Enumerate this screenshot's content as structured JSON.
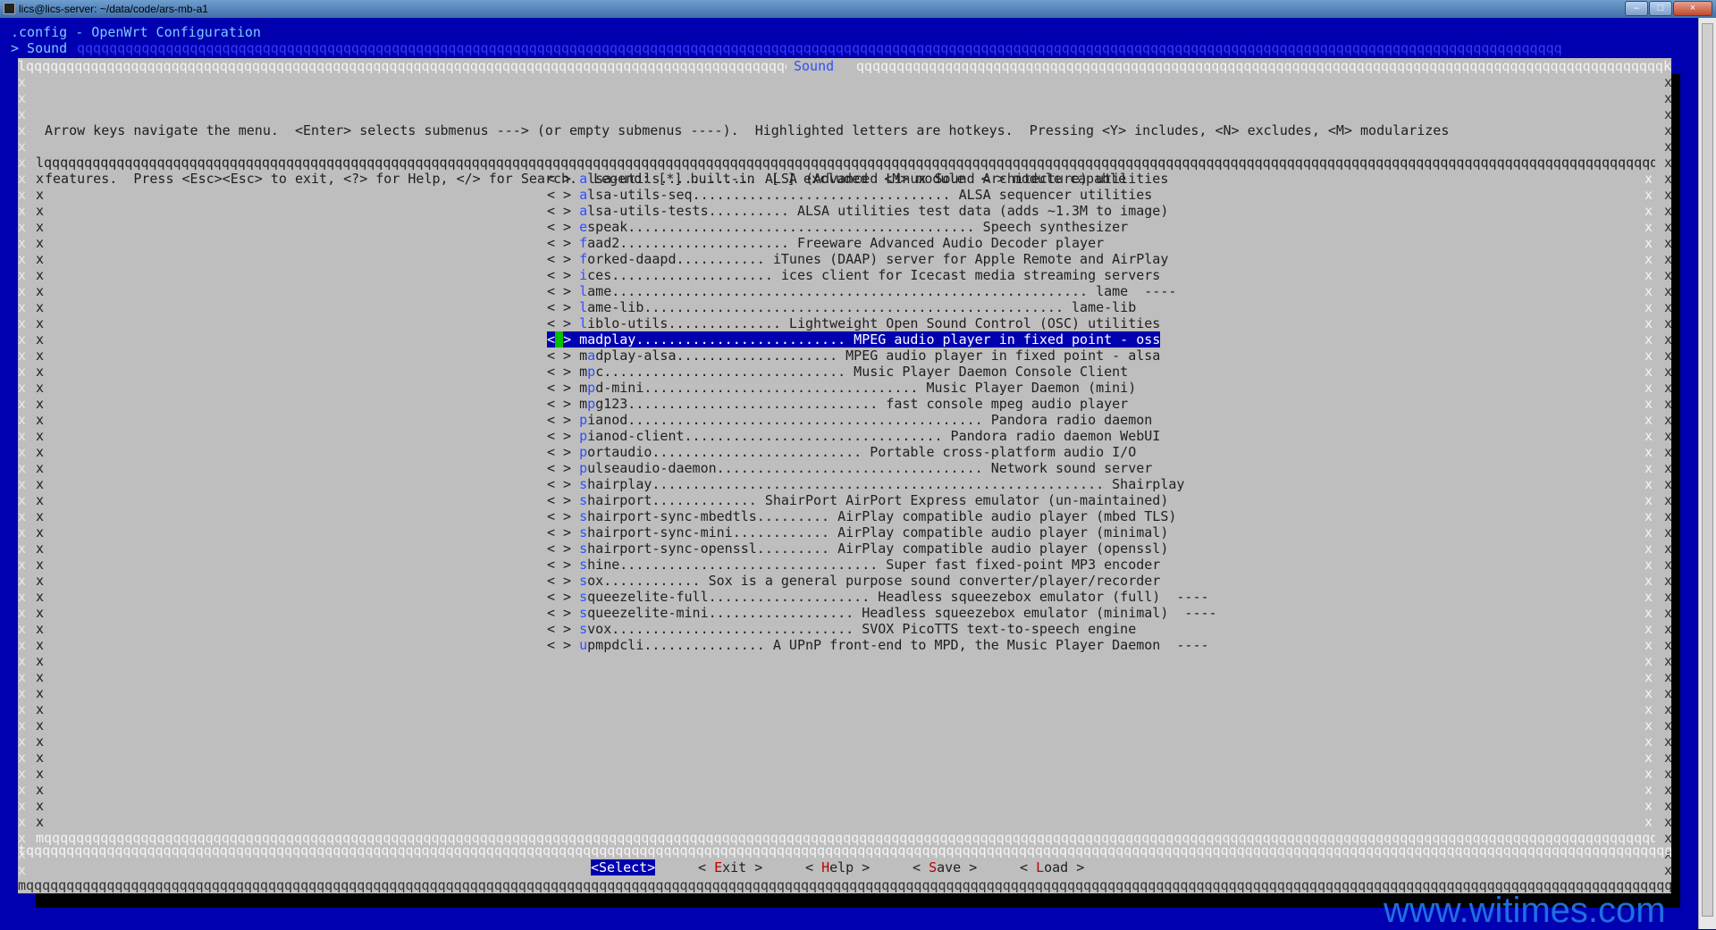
{
  "window": {
    "title": "lics@lics-server: ~/data/code/ars-mb-a1",
    "buttons": {
      "minimize": "–",
      "maximize": "□",
      "close": "×"
    }
  },
  "terminal": {
    "config_title": ".config - OpenWrt Configuration",
    "breadcrumb": "> Sound",
    "breadcrumb_fill": "qqqqqqqqqqqqqqqqqqqqqqqqqqqqqqqqqqqqqqqqqqqqqqqqqqqqqqqqqqqqqqqqqqqqqqqqqqqqqqqqqqqqqqqqqqqqqqqqqqqqqqqqqqqqqqqqqqqqqqqqqqqqqqqqqqqqqqqqqqqqqqqqqqqqqqqqqqqqqqqqqqqqqqqqqqqqqqqqqqqqqqqq"
  },
  "dialog": {
    "title": "Sound",
    "border_top_left": "lqqqqqqqqqqqqqqqqqqqqqqqqqqqqqqqqqqqqqqqqqqqqqqqqqqqqqqqqqqqqqqqqqqqqqqqqqqqqqqqqqqqqqqqqqqqqqqqqqqqqqqqqqqq",
    "border_top_right": "qqqqqqqqqqqqqqqqqqqqqqqqqqqqqqqqqqqqqqqqqqqqqqqqqqqqqqqqqqqqqqqqqqqqqqqqqqqqqqqqqqqqqqqqqqqqqqqqqqqqk",
    "help_line_1": "Arrow keys navigate the menu.  <Enter> selects submenus ---> (or empty submenus ----).  Highlighted letters are hotkeys.  Pressing <Y> includes, <N> excludes, <M> modularizes",
    "help_line_2": "features.  Press <Esc><Esc> to exit, <?> for Help, </> for Search.  Legend: [*] built-in  [ ] excluded  <M> module  < > module capable",
    "menu_border_top": "lqqqqqqqqqqqqqqqqqqqqqqqqqqqqqqqqqqqqqqqqqqqqqqqqqqqqqqqqqqqqqqqqqqqqqqqqqqqqqqqqqqqqqqqqqqqqqqqqqqqqqqqqqqqqqqqqqqqqqqqqqqqqqqqqqqqqqqqqqqqqqqqqqqqqqqqqqqqqqqqqqqqqqqqqqqqqqqqqqqqqqqqqqqqqqqqqqqqqqqqqqqqqqqqqqqqqqqqqqqqqk",
    "menu_border_bottom": "mqqqqqqqqqqqqqqqqqqqqqqqqqqqqqqqqqqqqqqqqqqqqqqqqqqqqqqqqqqqqqqqqqqqqqqqqqqqqqqqqqqqqqqqqqqqqqqqqqqqqqqqqqqqqqqqqqqqqqqqqqqqqqqqqqqqqqqqqqqqqqqqqqqqqqqqqqqqqqqqqqqqqqqqqqqqqqqqqqqqqqqqqqqqqqqqqqqqqqqqqqqqqqqqqqqqqqqqqqqqqqj",
    "button_separator": "tqqqqqqqqqqqqqqqqqqqqqqqqqqqqqqqqqqqqqqqqqqqqqqqqqqqqqqqqqqqqqqqqqqqqqqqqqqqqqqqqqqqqqqqqqqqqqqqqqqqqqqqqqqqqqqqqqqqqqqqqqqqqqqqqqqqqqqqqqqqqqqqqqqqqqqqqqqqqqqqqqqqqqqqqqqqqqqqqqqqqqqqqqqqqqqqqqqqqqqqqqqqqqqqqqqqqqqqqqqqqqqqqu",
    "border_bottom": "mqqqqqqqqqqqqqqqqqqqqqqqqqqqqqqqqqqqqqqqqqqqqqqqqqqqqqqqqqqqqqqqqqqqqqqqqqqqqqqqqqqqqqqqqqqqqqqqqqqqqqqqqqqqqqqqqqqqqqqqqqqqqqqqqqqqqqqqqqqqqqqqqqqqqqqqqqqqqqqqqqqqqqqqqqqqqqqqqqqqqqqqqqqqqqqqqqqqqqqqqqqqqqqqqqqqqqqqqqqqqqqqj",
    "border_char": "x",
    "menu_items": [
      {
        "prefix": "< > ",
        "hotkey": "a",
        "rest": "lsa-utils............ ALSA (Advanced Linux Sound Architecture) utilities",
        "trail": ""
      },
      {
        "prefix": "< > ",
        "hotkey": "a",
        "rest": "lsa-utils-seq................................ ALSA sequencer utilities",
        "trail": ""
      },
      {
        "prefix": "< > ",
        "hotkey": "a",
        "rest": "lsa-utils-tests.......... ALSA utilities test data (adds ~1.3M to image)",
        "trail": ""
      },
      {
        "prefix": "< > ",
        "hotkey": "e",
        "rest": "speak........................................... Speech synthesizer",
        "trail": ""
      },
      {
        "prefix": "< > ",
        "hotkey": "f",
        "rest": "aad2..................... Freeware Advanced Audio Decoder player",
        "trail": ""
      },
      {
        "prefix": "< > ",
        "hotkey": "f",
        "rest": "orked-daapd........... iTunes (DAAP) server for Apple Remote and AirPlay",
        "trail": ""
      },
      {
        "prefix": "< > ",
        "hotkey": "i",
        "rest": "ces.................... ices client for Icecast media streaming servers",
        "trail": ""
      },
      {
        "prefix": "< > ",
        "hotkey": "l",
        "rest": "ame........................................................... lame",
        "trail": "  ----"
      },
      {
        "prefix": "< > ",
        "hotkey": "l",
        "rest": "ame-lib.................................................... lame-lib",
        "trail": ""
      },
      {
        "prefix": "< > ",
        "hotkey": "l",
        "rest": "iblo-utils.............. Lightweight Open Sound Control (OSC) utilities",
        "trail": ""
      },
      {
        "prefix": "< > ",
        "hotkey": "m",
        "rest": "adplay.......................... MPEG audio player in fixed point - oss",
        "trail": "",
        "selected": true
      },
      {
        "prefix": "< > m",
        "hotkey": "a",
        "rest": "dplay-alsa.................... MPEG audio player in fixed point - alsa",
        "trail": ""
      },
      {
        "prefix": "< > m",
        "hotkey": "p",
        "rest": "c.............................. Music Player Daemon Console Client",
        "trail": ""
      },
      {
        "prefix": "< > m",
        "hotkey": "p",
        "rest": "d-mini.................................. Music Player Daemon (mini)",
        "trail": ""
      },
      {
        "prefix": "< > m",
        "hotkey": "p",
        "rest": "g123............................... fast console mpeg audio player",
        "trail": ""
      },
      {
        "prefix": "< > ",
        "hotkey": "p",
        "rest": "ianod............................................ Pandora radio daemon",
        "trail": ""
      },
      {
        "prefix": "< > ",
        "hotkey": "p",
        "rest": "ianod-client................................ Pandora radio daemon WebUI",
        "trail": ""
      },
      {
        "prefix": "< > ",
        "hotkey": "p",
        "rest": "ortaudio.......................... Portable cross-platform audio I/O",
        "trail": ""
      },
      {
        "prefix": "< > ",
        "hotkey": "p",
        "rest": "ulseaudio-daemon................................. Network sound server",
        "trail": ""
      },
      {
        "prefix": "< > ",
        "hotkey": "s",
        "rest": "hairplay........................................................ Shairplay",
        "trail": ""
      },
      {
        "prefix": "< > ",
        "hotkey": "s",
        "rest": "hairport............. ShairPort AirPort Express emulator (un-maintained)",
        "trail": ""
      },
      {
        "prefix": "< > ",
        "hotkey": "s",
        "rest": "hairport-sync-mbedtls......... AirPlay compatible audio player (mbed TLS)",
        "trail": ""
      },
      {
        "prefix": "< > ",
        "hotkey": "s",
        "rest": "hairport-sync-mini............ AirPlay compatible audio player (minimal)",
        "trail": ""
      },
      {
        "prefix": "< > ",
        "hotkey": "s",
        "rest": "hairport-sync-openssl......... AirPlay compatible audio player (openssl)",
        "trail": ""
      },
      {
        "prefix": "< > ",
        "hotkey": "s",
        "rest": "hine................................ Super fast fixed-point MP3 encoder",
        "trail": ""
      },
      {
        "prefix": "< > ",
        "hotkey": "s",
        "rest": "ox............ Sox is a general purpose sound converter/player/recorder",
        "trail": ""
      },
      {
        "prefix": "< > ",
        "hotkey": "s",
        "rest": "queezelite-full.................... Headless squeezebox emulator (full)",
        "trail": "  ----"
      },
      {
        "prefix": "< > ",
        "hotkey": "s",
        "rest": "queezelite-mini.................. Headless squeezebox emulator (minimal)",
        "trail": "  ----"
      },
      {
        "prefix": "< > ",
        "hotkey": "s",
        "rest": "vox.............................. SVOX PicoTTS text-to-speech engine",
        "trail": ""
      },
      {
        "prefix": "< > ",
        "hotkey": "u",
        "rest": "pmpdcli............... A UPnP front-end to MPD, the Music Player Daemon",
        "trail": "  ----"
      }
    ],
    "buttons": {
      "select": "<Select>",
      "exit_pre": "< ",
      "exit_hk": "E",
      "exit_rest": "xit >",
      "help_pre": "< ",
      "help_hk": "H",
      "help_rest": "elp >",
      "save_pre": "< ",
      "save_hk": "S",
      "save_rest": "ave >",
      "load_pre": "< ",
      "load_hk": "L",
      "load_rest": "oad >"
    }
  },
  "watermark": "www.witimes.com",
  "colors": {
    "terminal_bg": "#0000b0",
    "dialog_bg": "#bebebe",
    "hotkey": "#3050ff",
    "button_hotkey": "#c00000",
    "cursor": "#00c000",
    "watermark": "#1e6fe0"
  }
}
